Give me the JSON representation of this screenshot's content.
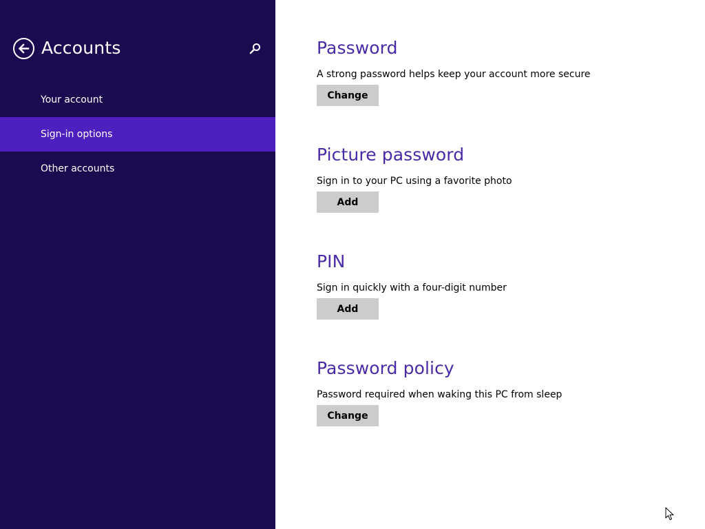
{
  "nav": {
    "title": "Accounts",
    "back_icon": "back-arrow-icon",
    "search_icon": "search-icon",
    "items": [
      {
        "label": "Your account",
        "selected": false
      },
      {
        "label": "Sign-in options",
        "selected": true
      },
      {
        "label": "Other accounts",
        "selected": false
      }
    ],
    "colors": {
      "pane_background": "#1a0a4f",
      "selected_background": "#4c1fbe",
      "text": "#ffffff"
    }
  },
  "content": {
    "sections": [
      {
        "title": "Password",
        "description": "A strong password helps keep your account more secure",
        "button_label": "Change"
      },
      {
        "title": "Picture password",
        "description": "Sign in to your PC using a favorite photo",
        "button_label": "Add"
      },
      {
        "title": "PIN",
        "description": "Sign in quickly with a four-digit number",
        "button_label": "Add"
      },
      {
        "title": "Password policy",
        "description": "Password required when waking this PC from sleep",
        "button_label": "Change"
      }
    ],
    "colors": {
      "heading": "#4a2aa6",
      "button_background": "#cccccc"
    }
  },
  "pointer_icon": "mouse-pointer-icon"
}
